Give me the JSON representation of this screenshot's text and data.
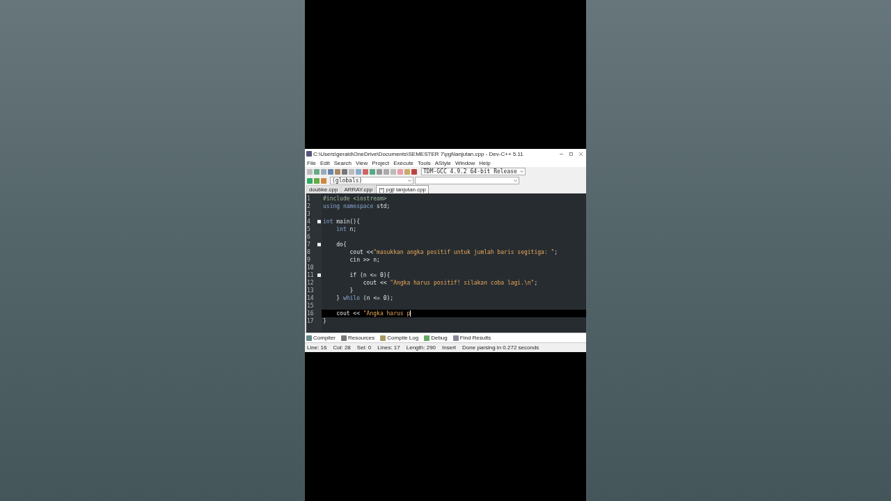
{
  "window": {
    "title": "C:\\Users\\gerald\\OneDrive\\Documents\\SEMESTER 7\\pgl\\lanjutan.cpp - Dev-C++ 5.11"
  },
  "menu": [
    "File",
    "Edit",
    "Search",
    "View",
    "Project",
    "Execute",
    "Tools",
    "AStyle",
    "Window",
    "Help"
  ],
  "toolbar": {
    "compiler": "TDM-GCC 4.9.2 64-bit Release",
    "scope": "(globals)"
  },
  "file_tabs": [
    {
      "label": "doubke.cpp",
      "selected": false
    },
    {
      "label": "ARRAY.cpp",
      "selected": false
    },
    {
      "label": "[*] pgjl lanjutan.cpp",
      "selected": true
    }
  ],
  "editor": {
    "lines": [
      {
        "number": "1",
        "fold": false,
        "current": false,
        "tokens": [
          {
            "text": "#include <iostream>",
            "kind": "preproc"
          }
        ]
      },
      {
        "number": "2",
        "fold": false,
        "current": false,
        "tokens": [
          {
            "text": "using namespace ",
            "kind": "keyword"
          },
          {
            "text": "std;",
            "kind": "plain"
          }
        ]
      },
      {
        "number": "3",
        "fold": false,
        "current": false
      },
      {
        "number": "4",
        "fold": true,
        "current": false,
        "tokens": [
          {
            "text": "int ",
            "kind": "keyword"
          },
          {
            "text": "main(){",
            "kind": "plain"
          }
        ]
      },
      {
        "number": "5",
        "fold": false,
        "current": false,
        "tokens": [
          {
            "text": "    int ",
            "kind": "keyword"
          },
          {
            "text": "n;",
            "kind": "plain"
          }
        ]
      },
      {
        "number": "6",
        "fold": false,
        "current": false
      },
      {
        "number": "7",
        "fold": true,
        "current": false,
        "tokens": [
          {
            "text": "    do{",
            "kind": "plain"
          }
        ]
      },
      {
        "number": "8",
        "fold": false,
        "current": false,
        "tokens": [
          {
            "text": "        cout <<",
            "kind": "plain"
          },
          {
            "text": "\"masukkan angka positif untuk jumlah baris segitiga: \"",
            "kind": "string"
          },
          {
            "text": ";",
            "kind": "plain"
          }
        ]
      },
      {
        "number": "9",
        "fold": false,
        "current": false,
        "tokens": [
          {
            "text": "        cin >> n;",
            "kind": "plain"
          }
        ]
      },
      {
        "number": "10",
        "fold": false,
        "current": false
      },
      {
        "number": "11",
        "fold": true,
        "current": false,
        "tokens": [
          {
            "text": "        if (n <= 0){",
            "kind": "plain"
          }
        ]
      },
      {
        "number": "12",
        "fold": false,
        "current": false,
        "tokens": [
          {
            "text": "            cout << ",
            "kind": "plain"
          },
          {
            "text": "\"Angka harus positif! silakan coba lagi.\\n\"",
            "kind": "string"
          },
          {
            "text": ";",
            "kind": "plain"
          }
        ]
      },
      {
        "number": "13",
        "fold": false,
        "current": false,
        "tokens": [
          {
            "text": "        }",
            "kind": "plain"
          }
        ]
      },
      {
        "number": "14",
        "fold": false,
        "current": false,
        "tokens": [
          {
            "text": "    } ",
            "kind": "plain"
          },
          {
            "text": "while ",
            "kind": "keyword"
          },
          {
            "text": "(n <= 0);",
            "kind": "plain"
          }
        ]
      },
      {
        "number": "15",
        "fold": false,
        "current": false
      },
      {
        "number": "16",
        "fold": false,
        "current": true,
        "tokens": [
          {
            "text": "    cout << ",
            "kind": "plain"
          },
          {
            "text": "\"Angka harus p",
            "kind": "string"
          }
        ]
      },
      {
        "number": "17",
        "fold": false,
        "current": false,
        "tokens": [
          {
            "text": "}",
            "kind": "plain"
          }
        ]
      }
    ]
  },
  "bottom_tabs": [
    "Compiler",
    "Resources",
    "Compile Log",
    "Debug",
    "Find Results"
  ],
  "status_bar": [
    {
      "label": "Line:",
      "value": "16"
    },
    {
      "label": "Col:",
      "value": "28"
    },
    {
      "label": "Sel:",
      "value": "0"
    },
    {
      "label": "Lines:",
      "value": "17"
    },
    {
      "label": "Length:",
      "value": "290"
    },
    {
      "value": "Insert"
    },
    {
      "value": "Done parsing in 0.272 seconds"
    }
  ]
}
